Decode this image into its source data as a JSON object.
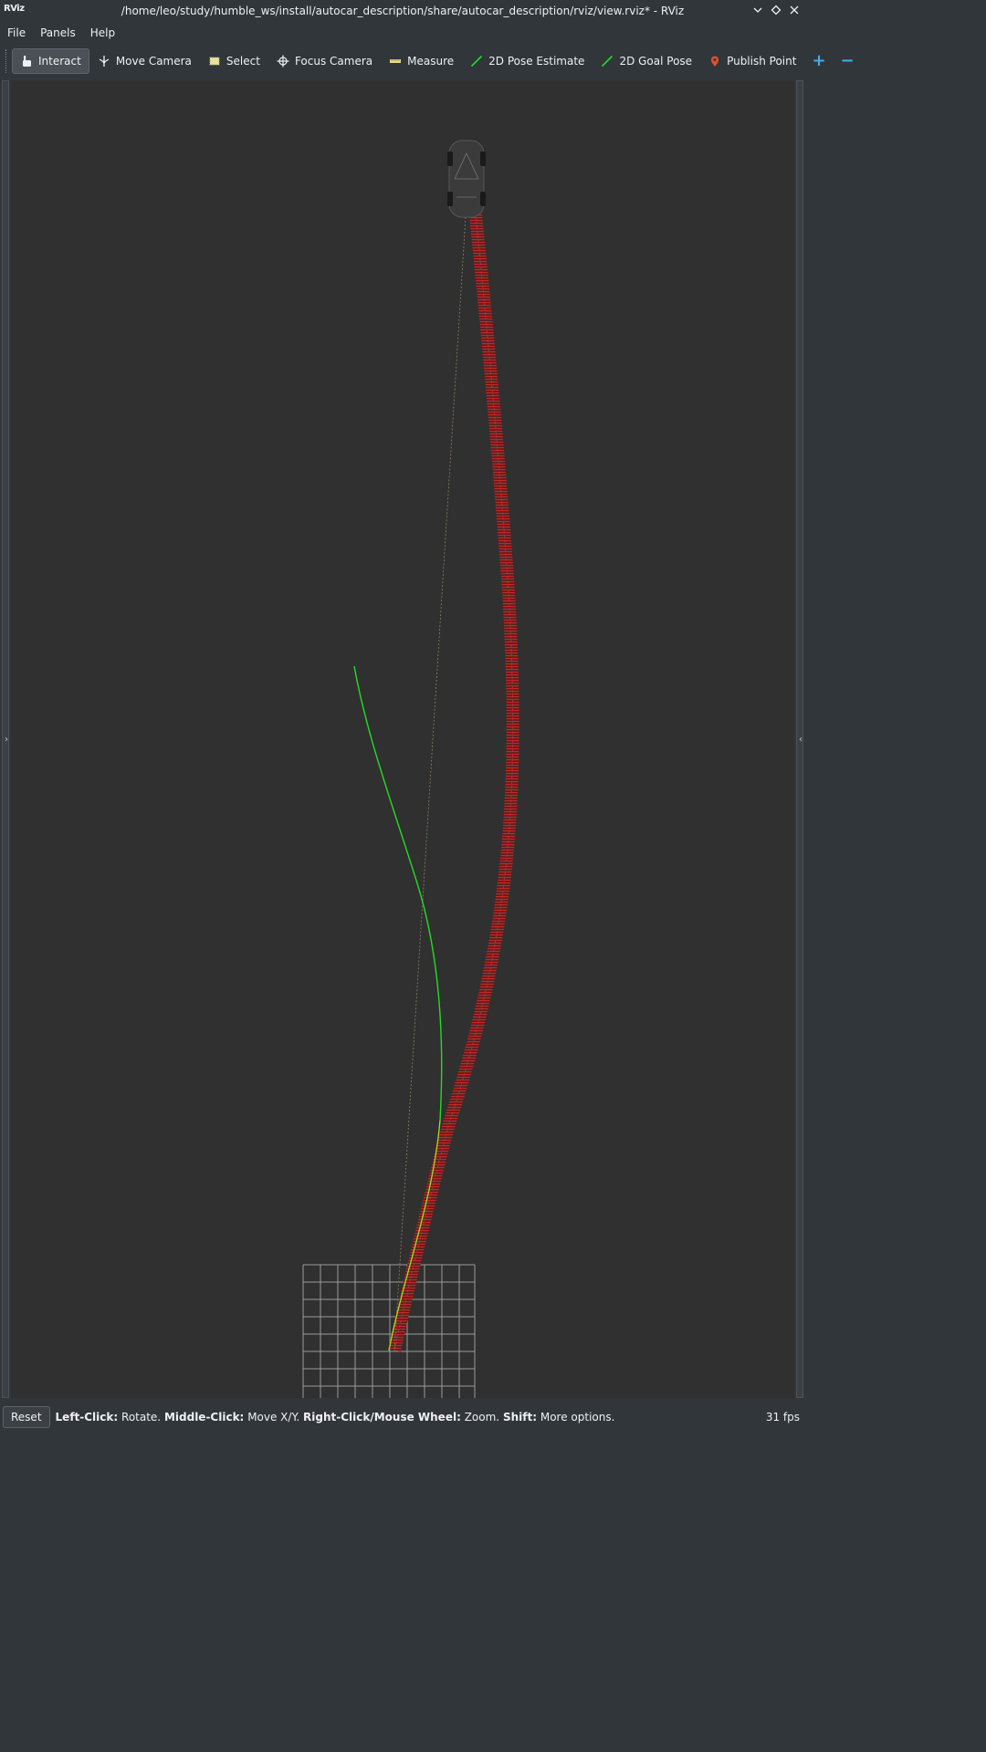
{
  "window": {
    "title": "/home/leo/study/humble_ws/install/autocar_description/share/autocar_description/rviz/view.rviz* - RViz",
    "logo": "RViz",
    "controls": [
      "chevron-down-icon",
      "diamond-icon",
      "close-icon"
    ]
  },
  "menu": {
    "file": "File",
    "panels": "Panels",
    "help": "Help"
  },
  "toolbar": {
    "interact": "Interact",
    "move_camera": "Move Camera",
    "select": "Select",
    "focus_camera": "Focus Camera",
    "measure": "Measure",
    "pose_estimate": "2D Pose Estimate",
    "goal_pose": "2D Goal Pose",
    "publish_point": "Publish Point",
    "add": "+",
    "remove": "−"
  },
  "colors": {
    "planned_path": "#22dd22",
    "trajectory": "#b02020",
    "grid": "#a0a0a0",
    "accent": "#3daee9"
  },
  "status": {
    "reset": "Reset",
    "left_click_key": "Left-Click:",
    "left_click_val": "Rotate.",
    "middle_click_key": "Middle-Click:",
    "middle_click_val": "Move X/Y.",
    "right_click_key": "Right-Click/Mouse Wheel:",
    "right_click_val": "Zoom.",
    "shift_key": "Shift:",
    "shift_val": "More options.",
    "fps": "31 fps"
  }
}
